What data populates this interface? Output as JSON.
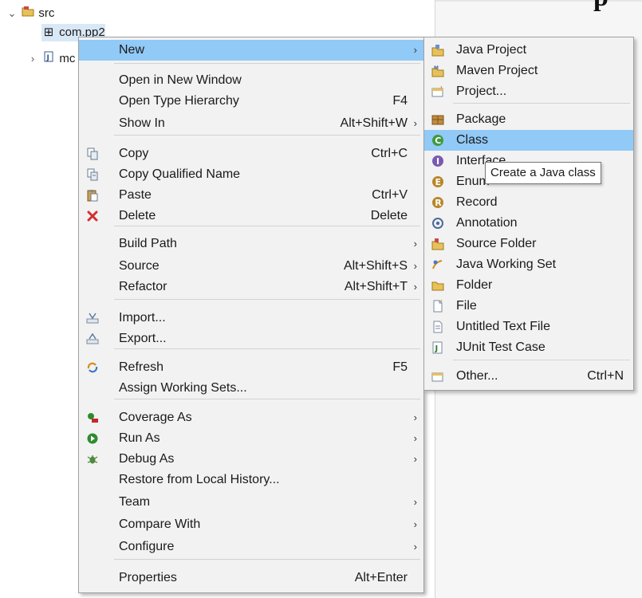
{
  "tree": {
    "src_label": "src",
    "package_label": "com.pp2",
    "file_label": "mc",
    "right_title_fragment": "p"
  },
  "context_menu": {
    "items": [
      {
        "label": "New",
        "shortcut": "",
        "submenu": true,
        "icon": ""
      },
      {
        "label": "Open in New Window",
        "shortcut": "",
        "submenu": false,
        "icon": ""
      },
      {
        "label": "Open Type Hierarchy",
        "shortcut": "F4",
        "submenu": false,
        "icon": ""
      },
      {
        "label": "Show In",
        "shortcut": "Alt+Shift+W",
        "submenu": true,
        "icon": ""
      },
      {
        "label": "Copy",
        "shortcut": "Ctrl+C",
        "submenu": false,
        "icon": "copy-icon"
      },
      {
        "label": "Copy Qualified Name",
        "shortcut": "",
        "submenu": false,
        "icon": "copy-qualified-icon"
      },
      {
        "label": "Paste",
        "shortcut": "Ctrl+V",
        "submenu": false,
        "icon": "paste-icon"
      },
      {
        "label": "Delete",
        "shortcut": "Delete",
        "submenu": false,
        "icon": "delete-icon"
      },
      {
        "label": "Build Path",
        "shortcut": "",
        "submenu": true,
        "icon": ""
      },
      {
        "label": "Source",
        "shortcut": "Alt+Shift+S",
        "submenu": true,
        "icon": ""
      },
      {
        "label": "Refactor",
        "shortcut": "Alt+Shift+T",
        "submenu": true,
        "icon": ""
      },
      {
        "label": "Import...",
        "shortcut": "",
        "submenu": false,
        "icon": "import-icon"
      },
      {
        "label": "Export...",
        "shortcut": "",
        "submenu": false,
        "icon": "export-icon"
      },
      {
        "label": "Refresh",
        "shortcut": "F5",
        "submenu": false,
        "icon": "refresh-icon"
      },
      {
        "label": "Assign Working Sets...",
        "shortcut": "",
        "submenu": false,
        "icon": ""
      },
      {
        "label": "Coverage As",
        "shortcut": "",
        "submenu": true,
        "icon": "coverage-icon"
      },
      {
        "label": "Run As",
        "shortcut": "",
        "submenu": true,
        "icon": "run-icon"
      },
      {
        "label": "Debug As",
        "shortcut": "",
        "submenu": true,
        "icon": "debug-icon"
      },
      {
        "label": "Restore from Local History...",
        "shortcut": "",
        "submenu": false,
        "icon": ""
      },
      {
        "label": "Team",
        "shortcut": "",
        "submenu": true,
        "icon": ""
      },
      {
        "label": "Compare With",
        "shortcut": "",
        "submenu": true,
        "icon": ""
      },
      {
        "label": "Configure",
        "shortcut": "",
        "submenu": true,
        "icon": ""
      },
      {
        "label": "Properties",
        "shortcut": "Alt+Enter",
        "submenu": false,
        "icon": ""
      }
    ]
  },
  "new_submenu": {
    "items": [
      {
        "label": "Java Project",
        "shortcut": "",
        "icon": "java-project-icon"
      },
      {
        "label": "Maven Project",
        "shortcut": "",
        "icon": "maven-project-icon"
      },
      {
        "label": "Project...",
        "shortcut": "",
        "icon": "project-icon"
      },
      {
        "label": "Package",
        "shortcut": "",
        "icon": "package-icon"
      },
      {
        "label": "Class",
        "shortcut": "",
        "icon": "class-icon"
      },
      {
        "label": "Interface",
        "shortcut": "",
        "icon": "interface-icon"
      },
      {
        "label": "Enum",
        "shortcut": "",
        "icon": "enum-icon"
      },
      {
        "label": "Record",
        "shortcut": "",
        "icon": "record-icon"
      },
      {
        "label": "Annotation",
        "shortcut": "",
        "icon": "annotation-icon"
      },
      {
        "label": "Source Folder",
        "shortcut": "",
        "icon": "source-folder-icon"
      },
      {
        "label": "Java Working Set",
        "shortcut": "",
        "icon": "java-working-set-icon"
      },
      {
        "label": "Folder",
        "shortcut": "",
        "icon": "folder-icon"
      },
      {
        "label": "File",
        "shortcut": "",
        "icon": "file-icon"
      },
      {
        "label": "Untitled Text File",
        "shortcut": "",
        "icon": "untitled-text-file-icon"
      },
      {
        "label": "JUnit Test Case",
        "shortcut": "",
        "icon": "junit-test-case-icon"
      },
      {
        "label": "Other...",
        "shortcut": "Ctrl+N",
        "icon": "other-icon"
      }
    ]
  },
  "tooltip": {
    "text": "Create a Java class"
  },
  "colors": {
    "highlight": "#91c9f7",
    "menu_bg": "#f2f2f2",
    "selection": "#d9e8f7"
  }
}
